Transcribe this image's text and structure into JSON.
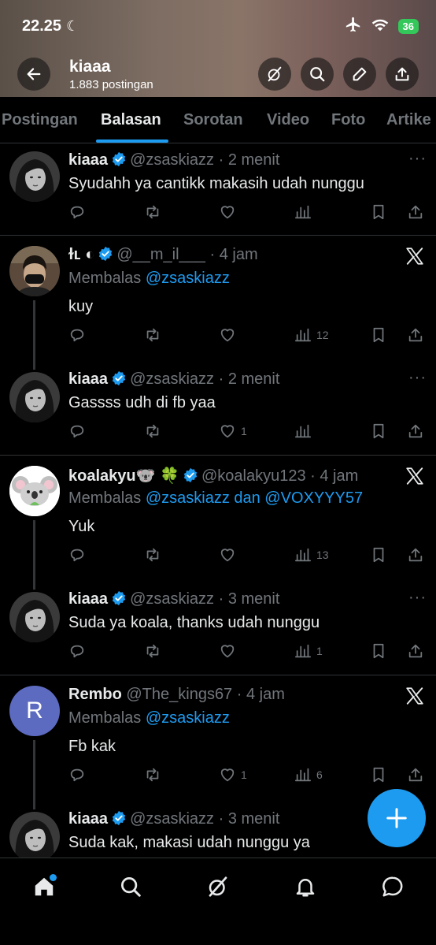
{
  "status_bar": {
    "time": "22.25",
    "battery": "36"
  },
  "profile": {
    "name": "kiaaa",
    "post_count": "1.883 postingan"
  },
  "tabs": [
    {
      "label": "Postingan"
    },
    {
      "label": "Balasan"
    },
    {
      "label": "Sorotan"
    },
    {
      "label": "Video"
    },
    {
      "label": "Foto"
    },
    {
      "label": "Artike"
    }
  ],
  "posts": [
    {
      "name": "kiaaa",
      "handle": "@zsaskiazz",
      "time": "· 2 menit",
      "text": "Syudahh ya cantikk makasih udah nunggu",
      "likes": "",
      "views": ""
    },
    {
      "name": "ɫʟ ◐",
      "handle": "@__m_il___",
      "time": "· 4 jam",
      "reply_prefix": "Membalas",
      "mention": "@zsaskiazz",
      "text": "kuy",
      "likes": "",
      "views": "12"
    },
    {
      "name": "kiaaa",
      "handle": "@zsaskiazz",
      "time": "· 2 menit",
      "text": "Gassss udh di fb yaa",
      "likes": "1",
      "views": ""
    },
    {
      "name": "koalakyu🐨 🍀",
      "handle": "@koalakyu123",
      "time": "· 4 jam",
      "reply_prefix": "Membalas",
      "mention": "@zsaskiazz dan @VOXYYY57",
      "text": "Yuk",
      "likes": "",
      "views": "13"
    },
    {
      "name": "kiaaa",
      "handle": "@zsaskiazz",
      "time": "· 3 menit",
      "text": "Suda ya koala, thanks udah nunggu",
      "likes": "",
      "views": "1"
    },
    {
      "name": "Rembo",
      "handle": "@The_kings67",
      "time": "· 4 jam",
      "reply_prefix": "Membalas",
      "mention": "@zsaskiazz",
      "text": "Fb kak",
      "likes": "1",
      "views": "6",
      "avatar_letter": "R"
    },
    {
      "name": "kiaaa",
      "handle": "@zsaskiazz",
      "time": "· 3 menit",
      "text": "Suda kak, makasi udah nunggu ya"
    }
  ],
  "colors": {
    "accent": "#1d9bf0",
    "background": "#000000",
    "muted": "#71767b",
    "avatar_purple": "#5c6bc0"
  }
}
